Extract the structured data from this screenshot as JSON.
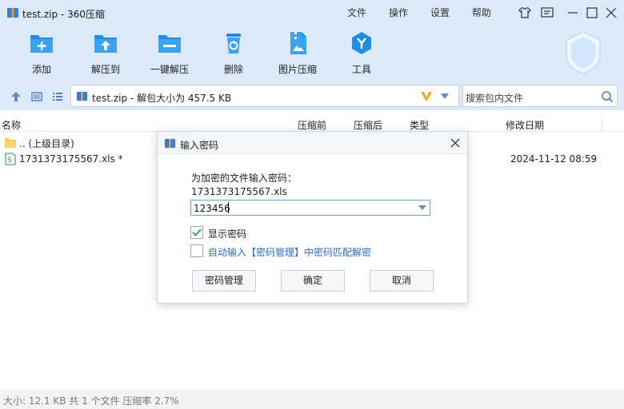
{
  "window": {
    "title": "test.zip - 360压缩",
    "menus": [
      "文件",
      "操作",
      "设置",
      "帮助"
    ]
  },
  "toolbar": {
    "items": [
      {
        "label": "添加",
        "icon": "add-icon"
      },
      {
        "label": "解压到",
        "icon": "extract-to-icon"
      },
      {
        "label": "一键解压",
        "icon": "one-click-extract-icon"
      },
      {
        "label": "删除",
        "icon": "trash-icon"
      },
      {
        "label": "图片压缩",
        "icon": "image-compress-icon"
      },
      {
        "label": "工具",
        "icon": "tools-icon"
      }
    ]
  },
  "navbar": {
    "path": "test.zip - 解包大小为 457.5 KB",
    "search_placeholder": "搜索包内文件"
  },
  "file_list": {
    "columns": [
      "名称",
      "压缩前",
      "压缩后",
      "类型",
      "修改日期"
    ],
    "rows": [
      {
        "name": ".. (上级目录)",
        "date": "",
        "icon": "folder-icon"
      },
      {
        "name": "1731373175567.xls *",
        "date": "2024-11-12 08:59",
        "icon": "spreadsheet-icon"
      }
    ]
  },
  "status": {
    "text": "大小: 12.1 KB 共 1 个文件 压缩率 2.7%"
  },
  "dialog": {
    "title": "输入密码",
    "prompt": "为加密的文件输入密码：",
    "file_name": "1731373175567.xls",
    "password_value": "123456",
    "show_password_label": "显示密码",
    "show_password_checked": true,
    "auto_input_label": "自动输入【密码管理】中密码匹配解密",
    "auto_input_checked": false,
    "buttons": {
      "manage": "密码管理",
      "ok": "确定",
      "cancel": "取消"
    }
  },
  "colors": {
    "chrome_bg": "#dbe9f8",
    "toolbar_icon": "#1f8ee0",
    "link_blue": "#2b6cc4",
    "check_green": "#2aa04a"
  }
}
